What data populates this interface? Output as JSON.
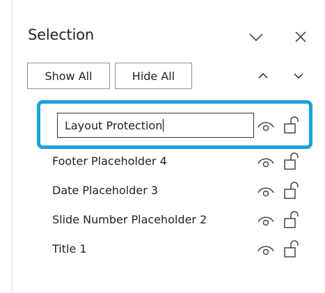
{
  "pane": {
    "title": "Selection",
    "show_all_label": "Show All",
    "hide_all_label": "Hide All"
  },
  "items": [
    {
      "label": "Layout Protection",
      "editing": true,
      "visible": true,
      "locked": false
    },
    {
      "label": "Footer Placeholder 4",
      "editing": false,
      "visible": true,
      "locked": false
    },
    {
      "label": "Date Placeholder 3",
      "editing": false,
      "visible": true,
      "locked": false
    },
    {
      "label": "Slide Number Placeholder 2",
      "editing": false,
      "visible": true,
      "locked": false
    },
    {
      "label": "Title 1",
      "editing": false,
      "visible": true,
      "locked": false
    }
  ],
  "colors": {
    "highlight": "#1aa3d9",
    "text": "#222222",
    "icon": "#444444"
  },
  "icons": {
    "options": "chevron-down-icon",
    "close": "close-icon",
    "bring_forward": "chevron-up-icon",
    "send_backward": "chevron-down-icon",
    "visibility": "eye-icon",
    "lock": "unlock-icon"
  }
}
